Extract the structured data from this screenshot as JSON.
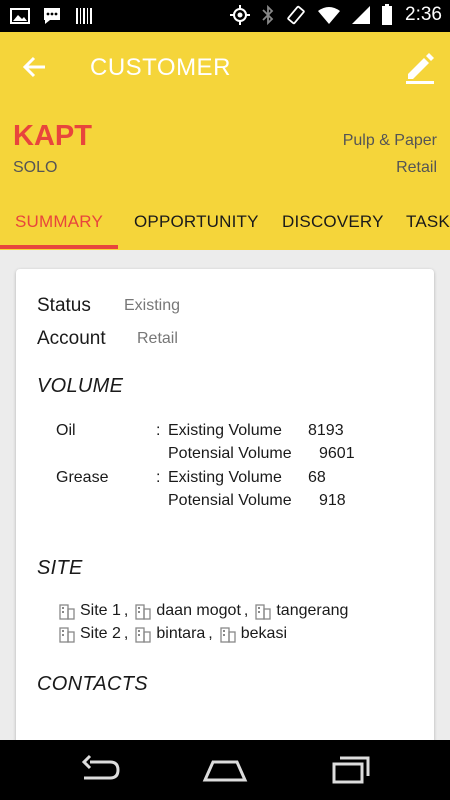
{
  "status_bar": {
    "time": "2:36",
    "left_icons": [
      "image-icon",
      "chat-icon",
      "barcode-icon"
    ],
    "right_icons": [
      "gps-icon",
      "bluetooth-icon",
      "rotate-icon",
      "wifi-icon",
      "signal-icon",
      "battery-icon"
    ]
  },
  "app_bar": {
    "title": "CUSTOMER"
  },
  "customer": {
    "name": "KAPT",
    "city": "SOLO",
    "industry": "Pulp & Paper",
    "segment": "Retail"
  },
  "tabs": [
    {
      "label": "SUMMARY",
      "active": true
    },
    {
      "label": "OPPORTUNITY",
      "active": false
    },
    {
      "label": "DISCOVERY",
      "active": false
    },
    {
      "label": "TASK",
      "active": false
    }
  ],
  "summary": {
    "status_label": "Status",
    "status_value": "Existing",
    "account_label": "Account",
    "account_value": "Retail",
    "volume_title": "VOLUME",
    "volume": [
      {
        "product": "Oil",
        "sep": ":",
        "existing_label": "Existing Volume",
        "existing_value": "8193",
        "potential_label": "Potensial Volume",
        "potential_value": "9601"
      },
      {
        "product": "Grease",
        "sep": ":",
        "existing_label": "Existing Volume",
        "existing_value": "68",
        "potential_label": "Potensial Volume",
        "potential_value": "918"
      }
    ],
    "site_title": "SITE",
    "sites": [
      {
        "name": "Site 1",
        "address": "daan mogot",
        "city": "tangerang"
      },
      {
        "name": "Site 2",
        "address": "bintara",
        "city": "bekasi"
      }
    ],
    "contacts_title": "CONTACTS"
  },
  "colors": {
    "primary": "#f5d53a",
    "accent": "#e8453c"
  }
}
